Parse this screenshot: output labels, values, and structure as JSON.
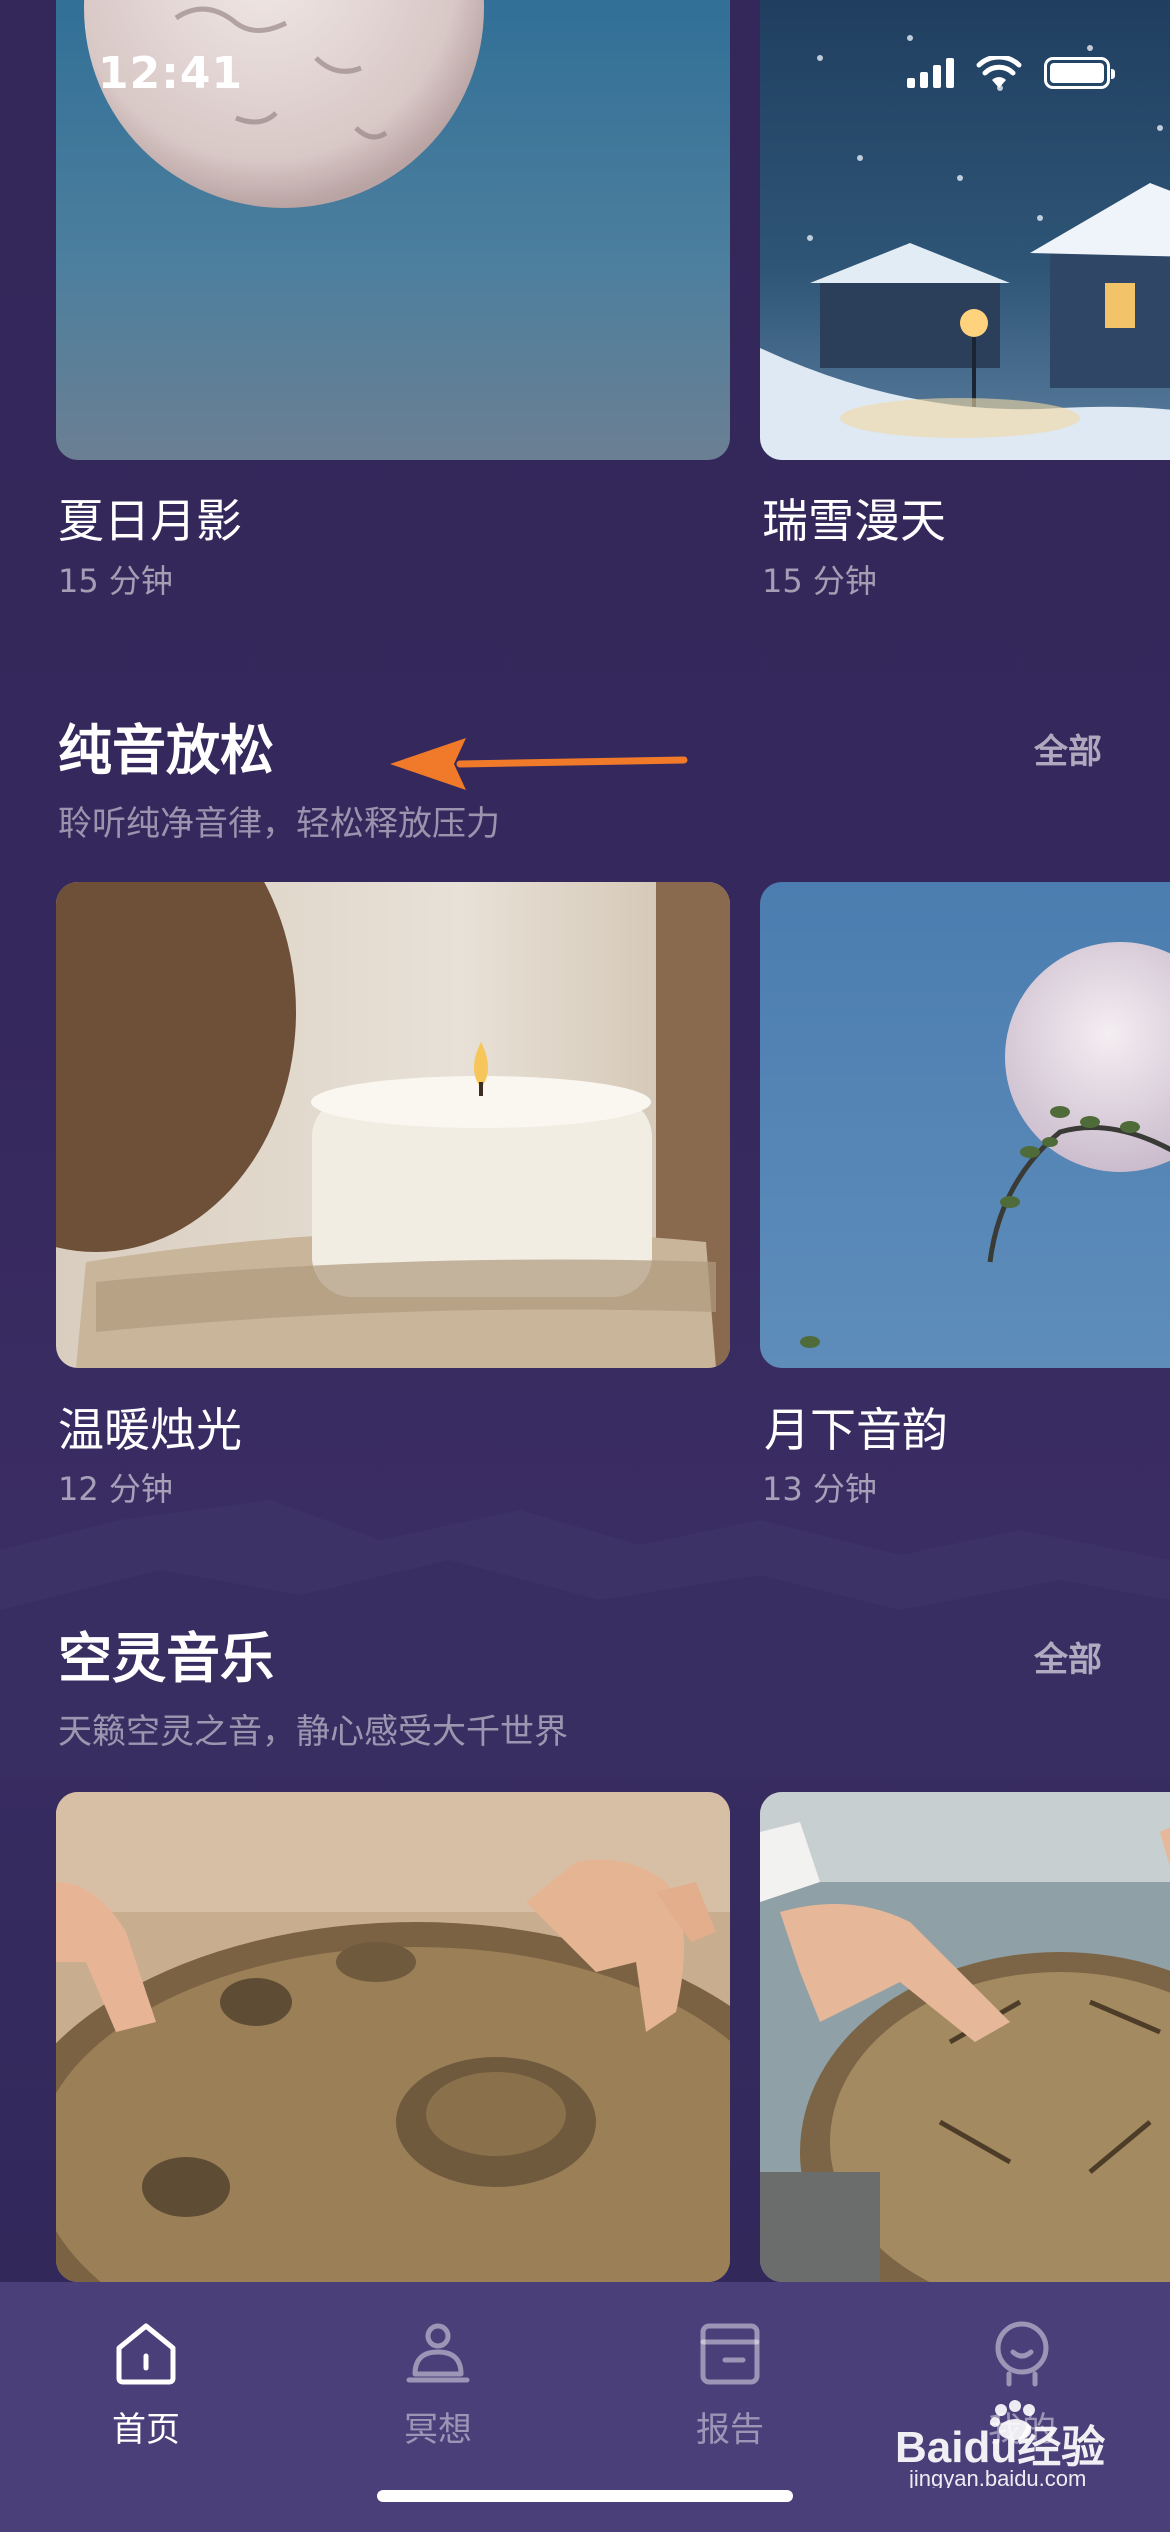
{
  "status_bar": {
    "time": "12:41"
  },
  "top_cards": [
    {
      "title": "夏日月影",
      "duration": "15 分钟"
    },
    {
      "title": "瑞雪漫天",
      "duration": "15 分钟"
    }
  ],
  "sections": [
    {
      "title": "纯音放松",
      "description": "聆听纯净音律，轻松释放压力",
      "all_label": "全部",
      "cards": [
        {
          "title": "温暖烛光",
          "duration": "12 分钟"
        },
        {
          "title": "月下音韵",
          "duration": "13 分钟"
        }
      ]
    },
    {
      "title": "空灵音乐",
      "description": "天籁空灵之音，静心感受大千世界",
      "all_label": "全部",
      "cards": [
        {
          "title": "",
          "duration": ""
        },
        {
          "title": "",
          "duration": ""
        }
      ]
    }
  ],
  "tab_bar": {
    "items": [
      {
        "label": "首页",
        "icon": "home-icon",
        "active": true
      },
      {
        "label": "冥想",
        "icon": "meditation-icon",
        "active": false
      },
      {
        "label": "报告",
        "icon": "report-icon",
        "active": false
      },
      {
        "label": "我的",
        "icon": "profile-icon",
        "active": false
      }
    ]
  },
  "watermark": {
    "text": "Baidu经验",
    "subtext": "jingyan.baidu.com"
  },
  "colors": {
    "background": "#35285c",
    "tab_bar": "#4b3f7a",
    "arrow": "#f07a2a"
  }
}
